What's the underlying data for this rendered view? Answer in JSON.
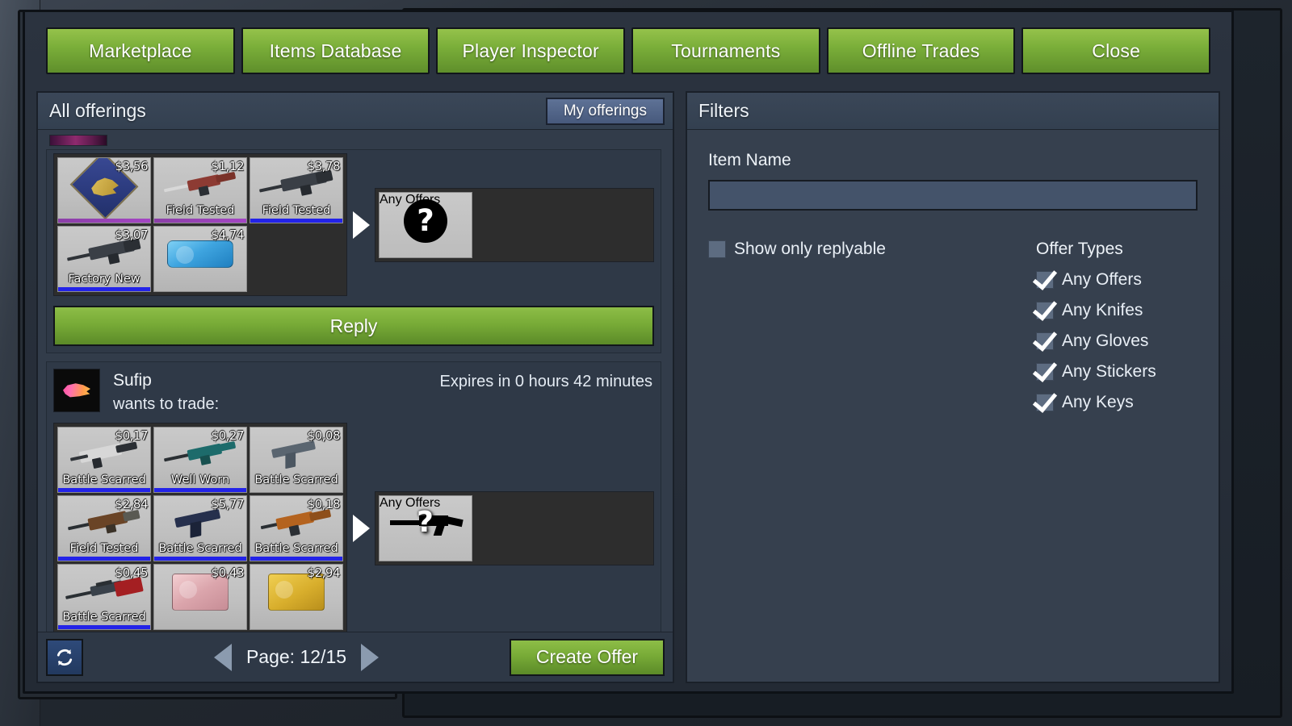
{
  "nav": {
    "buttons": [
      {
        "label": "Marketplace",
        "name": "nav-marketplace"
      },
      {
        "label": "Items Database",
        "name": "nav-items-database"
      },
      {
        "label": "Player Inspector",
        "name": "nav-player-inspector"
      },
      {
        "label": "Tournaments",
        "name": "nav-tournaments"
      },
      {
        "label": "Offline Trades",
        "name": "nav-offline-trades"
      },
      {
        "label": "Close",
        "name": "nav-close"
      }
    ]
  },
  "left_panel": {
    "title": "All offerings",
    "my_offerings_label": "My offerings",
    "reply_label": "Reply",
    "footer": {
      "refresh_icon": "refresh-icon",
      "prev_icon": "arrow-left-icon",
      "next_icon": "arrow-right-icon",
      "page_label": "Page: 12/15",
      "create_offer_label": "Create Offer"
    },
    "offers": [
      {
        "id": "offer-1",
        "partial": true,
        "items": [
          {
            "price": "$3,56",
            "condition": "",
            "rarity": "purple",
            "art": "medal"
          },
          {
            "price": "$1,12",
            "condition": "Field Tested",
            "rarity": "purple",
            "art": "rifle-red"
          },
          {
            "price": "$3,78",
            "condition": "Field Tested",
            "rarity": "blue",
            "art": "bullpup"
          },
          {
            "price": "$3,07",
            "condition": "Factory New",
            "rarity": "blue",
            "art": "bullpup"
          },
          {
            "price": "$4,74",
            "condition": "",
            "rarity": "none",
            "art": "case-blue"
          }
        ],
        "wants": {
          "label": "Any Offers",
          "icon": "question-mark-icon"
        }
      },
      {
        "id": "offer-2",
        "partial": false,
        "user_name": "Sufip",
        "wants_to_trade_label": "wants to trade:",
        "expires": "Expires in 0 hours 42 minutes",
        "avatar_icon": "panther-avatar-icon",
        "items": [
          {
            "price": "$0,17",
            "condition": "Battle Scarred",
            "rarity": "blue",
            "art": "smg-white"
          },
          {
            "price": "$0,27",
            "condition": "Well Worn",
            "rarity": "blue",
            "art": "rifle-teal"
          },
          {
            "price": "$0,08",
            "condition": "Battle Scarred",
            "rarity": "none",
            "art": "pistol-grey"
          },
          {
            "price": "$2,84",
            "condition": "Field Tested",
            "rarity": "blue",
            "art": "rifle-rust"
          },
          {
            "price": "$5,77",
            "condition": "Battle Scarred",
            "rarity": "blue",
            "art": "pistol-navy"
          },
          {
            "price": "$0,18",
            "condition": "Battle Scarred",
            "rarity": "blue",
            "art": "smg-orange"
          },
          {
            "price": "$0,45",
            "condition": "Battle Scarred",
            "rarity": "blue",
            "art": "sniper-red"
          },
          {
            "price": "$0,43",
            "condition": "",
            "rarity": "none",
            "art": "case-red"
          },
          {
            "price": "$2,94",
            "condition": "",
            "rarity": "none",
            "art": "case-gold"
          }
        ],
        "wants": {
          "label": "Any Offers",
          "icon": "rifle-question-icon"
        }
      }
    ]
  },
  "right_panel": {
    "title": "Filters",
    "item_name_label": "Item Name",
    "item_name_value": "",
    "item_name_placeholder": "",
    "show_only_replyable": {
      "label": "Show only replyable",
      "checked": false
    },
    "offer_types_title": "Offer Types",
    "offer_types": [
      {
        "label": "Any Offers",
        "checked": true
      },
      {
        "label": "Any Knifes",
        "checked": true
      },
      {
        "label": "Any Gloves",
        "checked": true
      },
      {
        "label": "Any Stickers",
        "checked": true
      },
      {
        "label": "Any Keys",
        "checked": true
      }
    ]
  },
  "colors": {
    "accent_green": "#7aae39",
    "panel_blue": "#36404e",
    "header_blue": "#3b4758",
    "rarity_blue": "#2323e8",
    "rarity_purple": "#a445c4",
    "button_blue": "#5e7296"
  }
}
